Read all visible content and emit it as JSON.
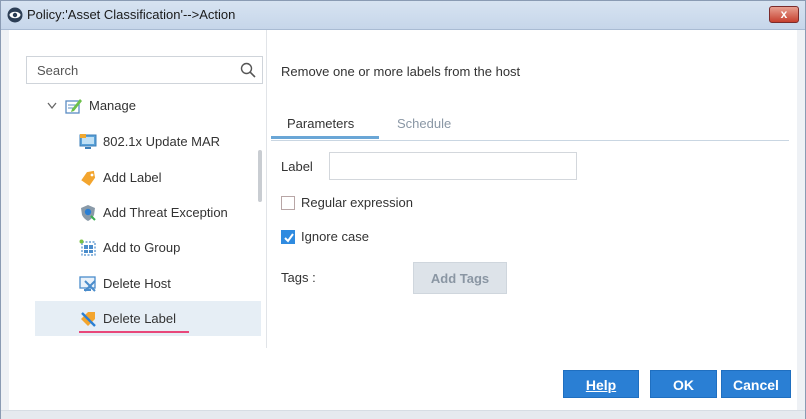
{
  "window": {
    "title": "Policy:'Asset Classification'-->Action",
    "close_glyph": "x"
  },
  "search": {
    "placeholder": "Search",
    "value": ""
  },
  "tree": {
    "group_label": "Manage",
    "items": [
      {
        "label": "802.1x Update MAR",
        "icon": "network-monitor-icon",
        "selected": false
      },
      {
        "label": "Add Label",
        "icon": "tag-icon",
        "selected": false
      },
      {
        "label": "Add Threat Exception",
        "icon": "shield-icon",
        "selected": false
      },
      {
        "label": "Add to Group",
        "icon": "group-icon",
        "selected": false
      },
      {
        "label": "Delete Host",
        "icon": "delete-host-icon",
        "selected": false
      },
      {
        "label": "Delete Label",
        "icon": "delete-label-icon",
        "selected": true
      }
    ]
  },
  "details": {
    "description": "Remove one or more labels from the host",
    "tabs": [
      {
        "label": "Parameters",
        "active": true
      },
      {
        "label": "Schedule",
        "active": false
      }
    ],
    "label_field": {
      "label": "Label",
      "value": ""
    },
    "regex_checkbox": {
      "label": "Regular expression",
      "checked": false
    },
    "ignore_case_checkbox": {
      "label": "Ignore case",
      "checked": true
    },
    "tags": {
      "label": "Tags :",
      "button_label": "Add Tags"
    }
  },
  "footer": {
    "help_label": "Help",
    "ok_label": "OK",
    "cancel_label": "Cancel"
  },
  "colors": {
    "accent": "#2a7fd4",
    "selected_bg": "#e6eef5",
    "underline_pink": "#e8477a",
    "tab_underline": "#6aa6d6"
  }
}
